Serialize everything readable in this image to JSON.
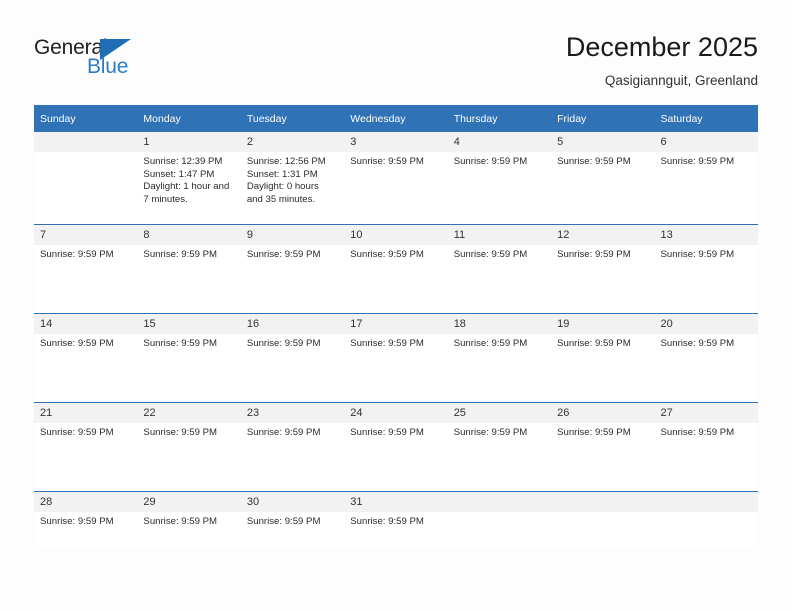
{
  "brand": {
    "name_part1": "General",
    "name_part2": "Blue",
    "triangle_icon": "triangle-icon",
    "accent_color": "#2d7dc4"
  },
  "header": {
    "title": "December 2025",
    "subtitle": "Qasigiannguit, Greenland"
  },
  "theme": {
    "header_blue": "#2f72b5",
    "daynum_band": "#f2f2f2",
    "page_background": "#fdfdfd"
  },
  "weekday_headers": [
    "Sunday",
    "Monday",
    "Tuesday",
    "Wednesday",
    "Thursday",
    "Friday",
    "Saturday"
  ],
  "weeks": [
    {
      "days": [
        {
          "num": "",
          "lines": []
        },
        {
          "num": "1",
          "lines": [
            "Sunrise: 12:39 PM",
            "Sunset: 1:47 PM",
            "Daylight: 1 hour and 7 minutes."
          ]
        },
        {
          "num": "2",
          "lines": [
            "Sunrise: 12:56 PM",
            "Sunset: 1:31 PM",
            "Daylight: 0 hours and 35 minutes."
          ]
        },
        {
          "num": "3",
          "lines": [
            "Sunrise: 9:59 PM"
          ]
        },
        {
          "num": "4",
          "lines": [
            "Sunrise: 9:59 PM"
          ]
        },
        {
          "num": "5",
          "lines": [
            "Sunrise: 9:59 PM"
          ]
        },
        {
          "num": "6",
          "lines": [
            "Sunrise: 9:59 PM"
          ]
        }
      ]
    },
    {
      "days": [
        {
          "num": "7",
          "lines": [
            "Sunrise: 9:59 PM"
          ]
        },
        {
          "num": "8",
          "lines": [
            "Sunrise: 9:59 PM"
          ]
        },
        {
          "num": "9",
          "lines": [
            "Sunrise: 9:59 PM"
          ]
        },
        {
          "num": "10",
          "lines": [
            "Sunrise: 9:59 PM"
          ]
        },
        {
          "num": "11",
          "lines": [
            "Sunrise: 9:59 PM"
          ]
        },
        {
          "num": "12",
          "lines": [
            "Sunrise: 9:59 PM"
          ]
        },
        {
          "num": "13",
          "lines": [
            "Sunrise: 9:59 PM"
          ]
        }
      ]
    },
    {
      "days": [
        {
          "num": "14",
          "lines": [
            "Sunrise: 9:59 PM"
          ]
        },
        {
          "num": "15",
          "lines": [
            "Sunrise: 9:59 PM"
          ]
        },
        {
          "num": "16",
          "lines": [
            "Sunrise: 9:59 PM"
          ]
        },
        {
          "num": "17",
          "lines": [
            "Sunrise: 9:59 PM"
          ]
        },
        {
          "num": "18",
          "lines": [
            "Sunrise: 9:59 PM"
          ]
        },
        {
          "num": "19",
          "lines": [
            "Sunrise: 9:59 PM"
          ]
        },
        {
          "num": "20",
          "lines": [
            "Sunrise: 9:59 PM"
          ]
        }
      ]
    },
    {
      "days": [
        {
          "num": "21",
          "lines": [
            "Sunrise: 9:59 PM"
          ]
        },
        {
          "num": "22",
          "lines": [
            "Sunrise: 9:59 PM"
          ]
        },
        {
          "num": "23",
          "lines": [
            "Sunrise: 9:59 PM"
          ]
        },
        {
          "num": "24",
          "lines": [
            "Sunrise: 9:59 PM"
          ]
        },
        {
          "num": "25",
          "lines": [
            "Sunrise: 9:59 PM"
          ]
        },
        {
          "num": "26",
          "lines": [
            "Sunrise: 9:59 PM"
          ]
        },
        {
          "num": "27",
          "lines": [
            "Sunrise: 9:59 PM"
          ]
        }
      ]
    },
    {
      "days": [
        {
          "num": "28",
          "lines": [
            "Sunrise: 9:59 PM"
          ]
        },
        {
          "num": "29",
          "lines": [
            "Sunrise: 9:59 PM"
          ]
        },
        {
          "num": "30",
          "lines": [
            "Sunrise: 9:59 PM"
          ]
        },
        {
          "num": "31",
          "lines": [
            "Sunrise: 9:59 PM"
          ]
        },
        {
          "num": "",
          "lines": []
        },
        {
          "num": "",
          "lines": []
        },
        {
          "num": "",
          "lines": []
        }
      ]
    }
  ]
}
